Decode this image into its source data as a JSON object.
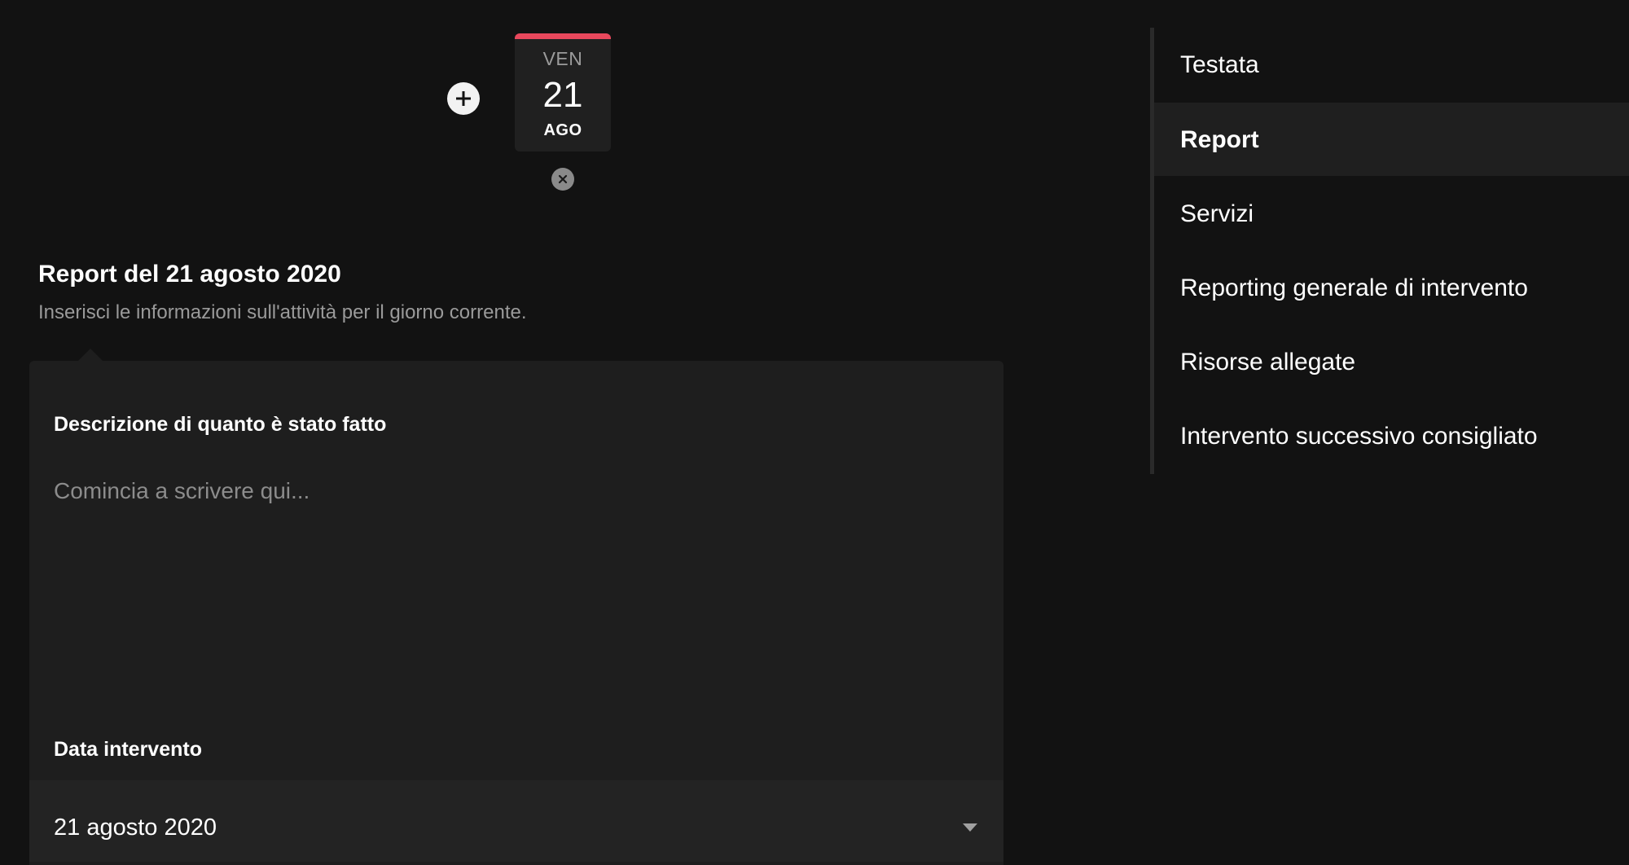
{
  "date_picker": {
    "add_label": "+",
    "selected_day": {
      "weekday": "VEN",
      "day": "21",
      "month": "AGO"
    },
    "accent_color": "#e8485c",
    "remove_icon": "close-icon"
  },
  "report": {
    "title": "Report del 21 agosto 2020",
    "subtitle": "Inserisci le informazioni sull'attività per il giorno corrente.",
    "description": {
      "label": "Descrizione di quanto è stato fatto",
      "placeholder": "Comincia a scrivere qui...",
      "value": ""
    },
    "date": {
      "label": "Data intervento",
      "value": "21 agosto 2020",
      "icon": "caret-down-icon"
    }
  },
  "nav": {
    "active_index": 1,
    "items": [
      {
        "label": "Testata"
      },
      {
        "label": "Report"
      },
      {
        "label": "Servizi"
      },
      {
        "label": "Reporting generale di intervento"
      },
      {
        "label": "Risorse allegate"
      },
      {
        "label": "Intervento successivo consigliato"
      }
    ]
  }
}
